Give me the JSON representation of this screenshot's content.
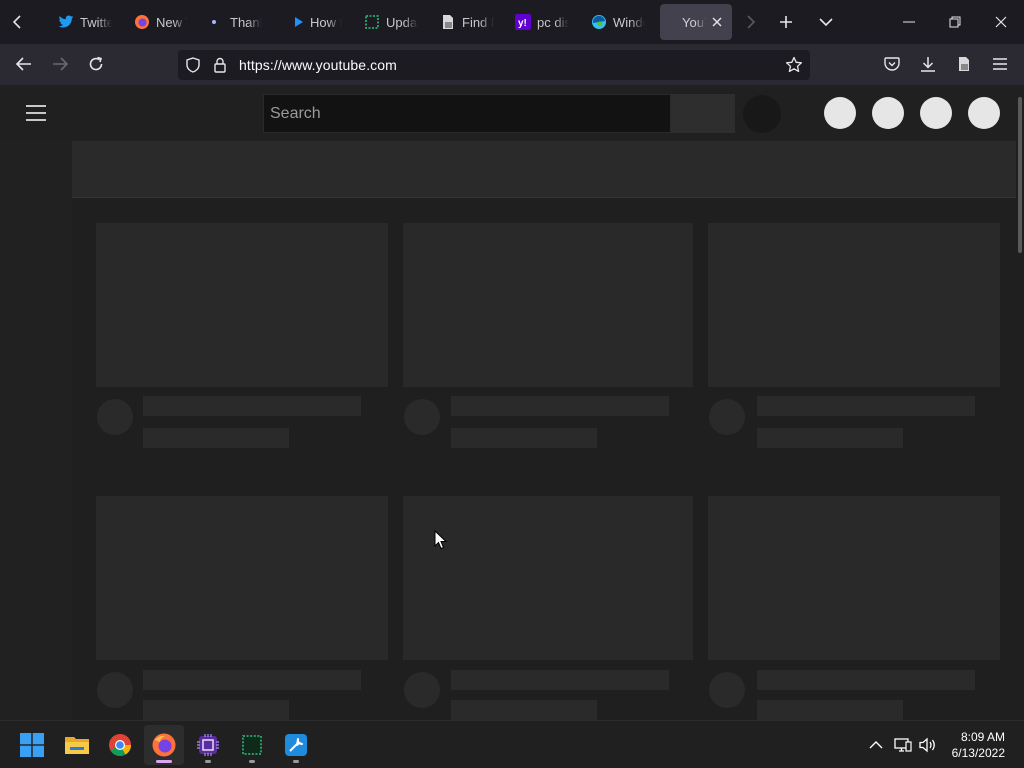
{
  "browser": {
    "tabs": [
      {
        "label": "Twitter",
        "icon": "twitter-icon",
        "color": "#1d9bf0"
      },
      {
        "label": "New Tab",
        "icon": "firefox-icon",
        "color": "#ff7139"
      },
      {
        "label": "Thank",
        "icon": "dot-icon",
        "color": "#9fb8ff"
      },
      {
        "label": "How t",
        "icon": "play-icon",
        "color": "#1e90ff"
      },
      {
        "label": "Updat",
        "icon": "circuit-icon",
        "color": "#2ec27e"
      },
      {
        "label": "Find M",
        "icon": "document-icon",
        "color": "#c8c8cc"
      },
      {
        "label": "pc dis",
        "icon": "yahoo-icon",
        "color": "#6001d2"
      },
      {
        "label": "Windo",
        "icon": "edge-icon",
        "color": "#35c1f1"
      },
      {
        "label": "YouTube",
        "icon": "youtube-icon",
        "color": "#ff0000",
        "active": true
      }
    ],
    "url": "https://www.youtube.com",
    "accent": "#42414d"
  },
  "youtube": {
    "search_placeholder": "Search"
  },
  "taskbar": {
    "apps": [
      {
        "name": "windows-start"
      },
      {
        "name": "file-explorer"
      },
      {
        "name": "chrome"
      },
      {
        "name": "firefox",
        "active": true
      },
      {
        "name": "cpu-app"
      },
      {
        "name": "circuit-app"
      },
      {
        "name": "tools-app"
      }
    ],
    "time": "8:09 AM",
    "date": "6/13/2022"
  }
}
